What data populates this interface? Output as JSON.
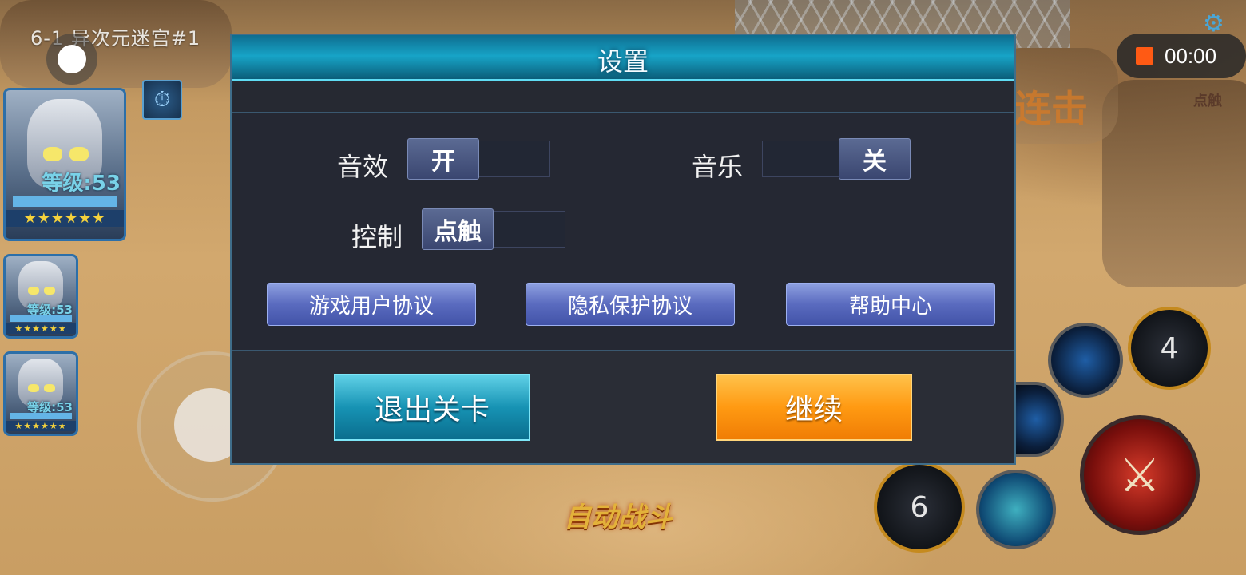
{
  "hud": {
    "level_title": "6-1 异次元迷宫#1",
    "record_time": "00:00",
    "combo_text": "连击",
    "touch_tip": "点触",
    "auto_battle": "自动战斗"
  },
  "party": [
    {
      "level": "等级:53",
      "stars": "★★★★★★"
    },
    {
      "level": "等级:53",
      "stars": "★★★★★★"
    },
    {
      "level": "等级:53",
      "stars": "★★★★★★"
    }
  ],
  "skills": [
    {
      "cooldown": "4"
    },
    {
      "cooldown": "6"
    }
  ],
  "settings": {
    "title": "设置",
    "sound_label": "音效",
    "sound_value": "开",
    "music_label": "音乐",
    "music_value": "关",
    "control_label": "控制",
    "control_value": "点触",
    "links": [
      "游戏用户协议",
      "隐私保护协议",
      "帮助中心"
    ],
    "exit_label": "退出关卡",
    "continue_label": "继续"
  },
  "icons": {
    "record": "stop-square-icon",
    "gear": "gear-icon",
    "clock": "clock-icon",
    "attack": "crossed-swords-icon"
  }
}
